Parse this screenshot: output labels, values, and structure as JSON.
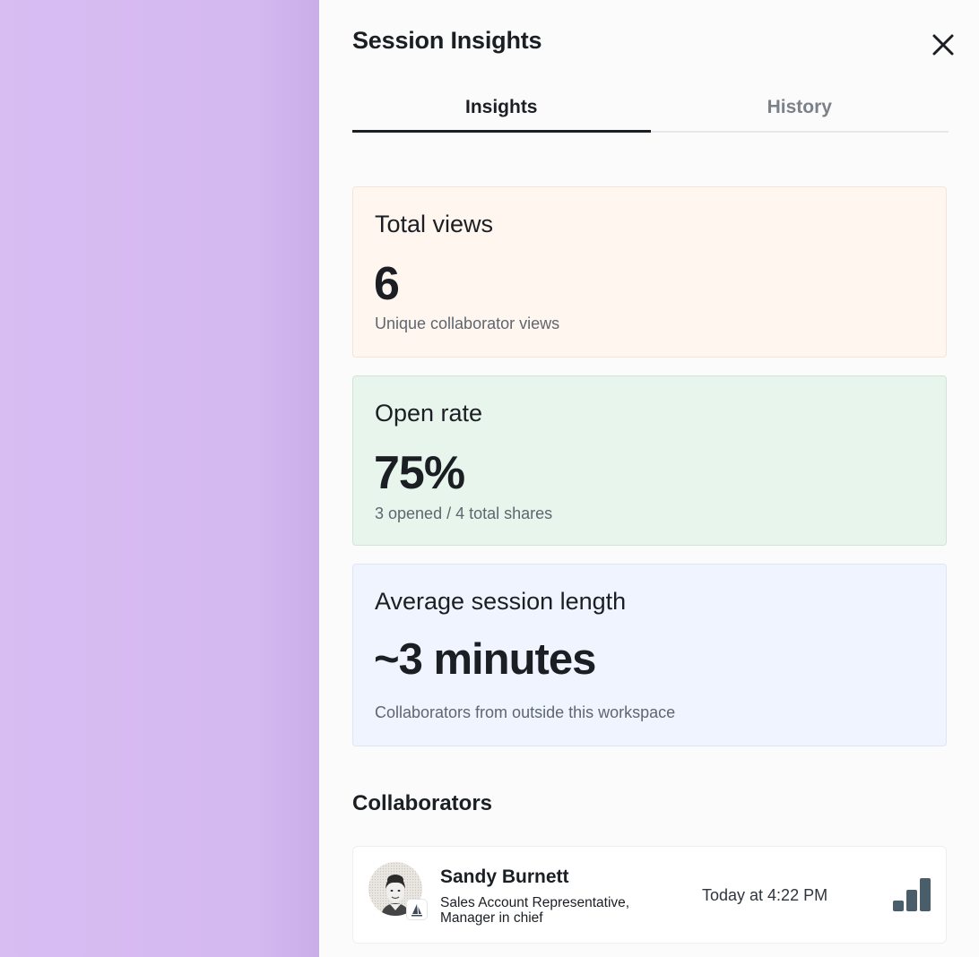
{
  "panel": {
    "title": "Session Insights",
    "close_icon": "close-icon"
  },
  "tabs": [
    {
      "label": "Insights",
      "active": true
    },
    {
      "label": "History",
      "active": false
    }
  ],
  "cards": {
    "views": {
      "label": "Total views",
      "value": "6",
      "sub": "Unique collaborator views",
      "bg": "#fff6ef"
    },
    "open": {
      "label": "Open rate",
      "value": "75%",
      "sub": "3 opened / 4 total shares",
      "bg": "#e8f5ec"
    },
    "session": {
      "label": "Average session length",
      "value": "~3 minutes",
      "sub": "Collaborators from outside this workspace",
      "bg": "#eff4fe"
    }
  },
  "collaborators": {
    "title": "Collaborators",
    "items": [
      {
        "name": "Sandy Burnett",
        "role": "Sales Account Representative, Manager in chief",
        "time": "Today at 4:22 PM",
        "avatar_icon": "avatar",
        "badge_icon": "company-logo-icon",
        "activity_icon": "signal-bars-icon"
      }
    ]
  },
  "colors": {
    "backdrop": "#d6bbf1",
    "panel": "#fbfbfb",
    "text": "#1b1f24",
    "muted": "#7b8189",
    "signal": "#4a5d6b"
  }
}
